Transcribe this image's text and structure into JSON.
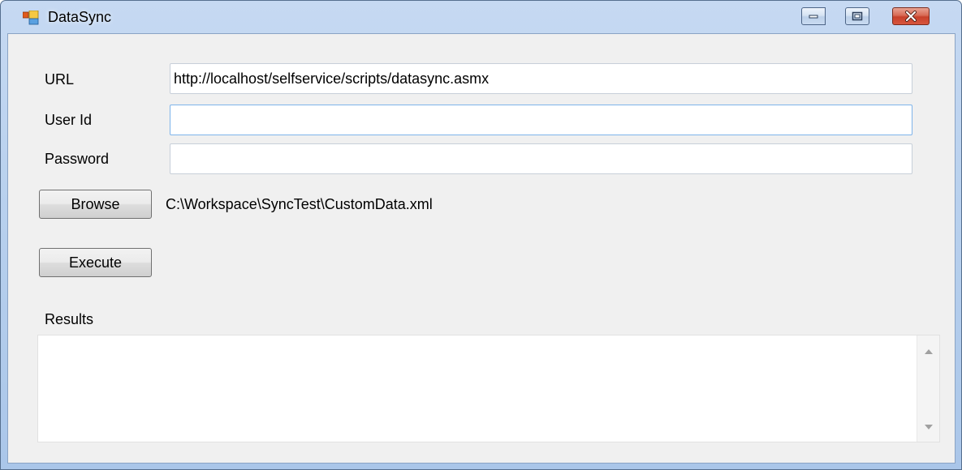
{
  "window": {
    "title": "DataSync",
    "icon": "app-window-icon",
    "controls": {
      "minimize": "minimize-icon",
      "maximize": "maximize-icon",
      "close": "close-icon"
    }
  },
  "form": {
    "url_label": "URL",
    "url_value": "http://localhost/selfservice/scripts/datasync.asmx",
    "userid_label": "User Id",
    "userid_value": "",
    "password_label": "Password",
    "password_value": ""
  },
  "actions": {
    "browse_label": "Browse",
    "file_path": "C:\\Workspace\\SyncTest\\CustomData.xml",
    "execute_label": "Execute"
  },
  "results": {
    "label": "Results",
    "content": ""
  },
  "colors": {
    "title_gradient": "#c6d9f2",
    "client_bg": "#f0f0f0",
    "close_red": "#c7402a",
    "focus_border": "#7eb4ea"
  }
}
